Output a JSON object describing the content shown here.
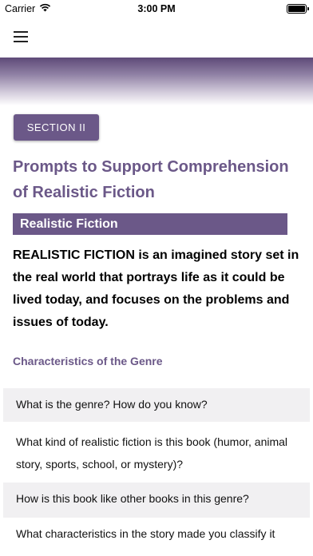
{
  "status_bar": {
    "carrier": "Carrier",
    "time": "3:00 PM",
    "wifi_icon": "wifi-icon",
    "battery_icon": "battery-icon"
  },
  "nav": {
    "menu_icon": "hamburger-menu-icon"
  },
  "colors": {
    "accent": "#6b5888",
    "shaded_row": "#f1f0f2"
  },
  "content": {
    "section_label": "SECTION II",
    "title": "Prompts to Support Comprehension of Realistic Fiction",
    "genre_bar": "Realistic Fiction",
    "definition": "REALISTIC FICTION is an imagined story set in the real world that portrays life as it could be lived today, and focuses on the problems and issues of today.",
    "characteristics_heading": "Characteristics of the Genre",
    "prompts": [
      "What is the genre? How do you know?",
      "What kind of realistic fiction is this book (humor, animal story, sports, school, or mystery)?",
      "How is this book like other books in this genre?",
      "What characteristics in the story made you classify it"
    ]
  }
}
